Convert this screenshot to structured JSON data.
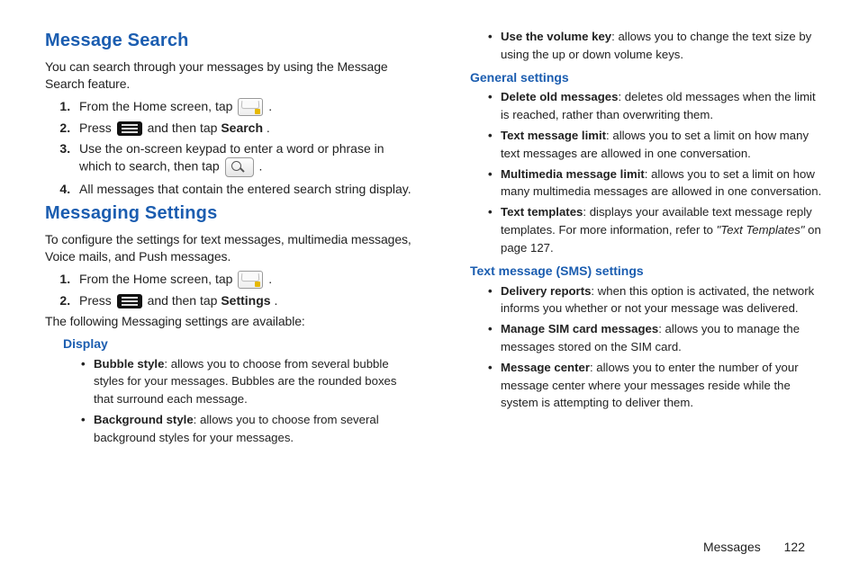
{
  "left": {
    "h1": "Message Search",
    "intro1": "You can search through your messages by using the Message Search feature.",
    "steps1": {
      "s1a": "From the Home screen, tap ",
      "s1b": ".",
      "s2a": "Press ",
      "s2b": " and then tap ",
      "s2c": "Search",
      "s2d": ".",
      "s3": "Use the on-screen keypad to enter a word or phrase in which to search, then tap ",
      "s3b": ".",
      "s4": "All messages that contain the entered search string display."
    },
    "h2": "Messaging Settings",
    "intro2": "To configure the settings for text messages, multimedia messages, Voice mails, and Push messages.",
    "steps2": {
      "s1a": "From the Home screen, tap ",
      "s1b": ".",
      "s2a": "Press ",
      "s2b": " and then tap ",
      "s2c": "Settings",
      "s2d": "."
    },
    "intro3": "The following Messaging settings are available:",
    "display_h": "Display",
    "display_items": {
      "bubble_b": "Bubble style",
      "bubble_t": ": allows you to choose from several bubble styles for your messages. Bubbles are the rounded boxes that surround each message.",
      "bg_b": "Background style",
      "bg_t": ": allows you to choose from several background styles for your messages."
    }
  },
  "right": {
    "top_item": {
      "vol_b": "Use the volume key",
      "vol_t": ": allows you to change the text size by using the up or down volume keys."
    },
    "general_h": "General settings",
    "general": {
      "del_b": "Delete old messages",
      "del_t": ": deletes old messages when the limit is reached, rather than overwriting them.",
      "txt_b": "Text message limit",
      "txt_t": ": allows you to set a limit on how many text messages are allowed in one conversation.",
      "mms_b": "Multimedia message limit",
      "mms_t": ": allows you to set a limit on how many multimedia messages are allowed in one conversation.",
      "tpl_b": "Text templates",
      "tpl_t1": ": displays your available text message reply templates. For more information, refer to ",
      "tpl_i": "\"Text Templates\"",
      "tpl_t2": " on page 127."
    },
    "sms_h": "Text message (SMS) settings",
    "sms": {
      "dr_b": "Delivery reports",
      "dr_t": ": when this option is activated, the network informs you whether or not your message was delivered.",
      "sim_b": "Manage SIM card messages",
      "sim_t": ": allows you to manage the messages stored on the SIM card.",
      "mc_b": "Message center",
      "mc_t": ": allows you to enter the number of your message center where your messages reside while the system is attempting to deliver them."
    }
  },
  "footer": {
    "section": "Messages",
    "page": "122"
  }
}
